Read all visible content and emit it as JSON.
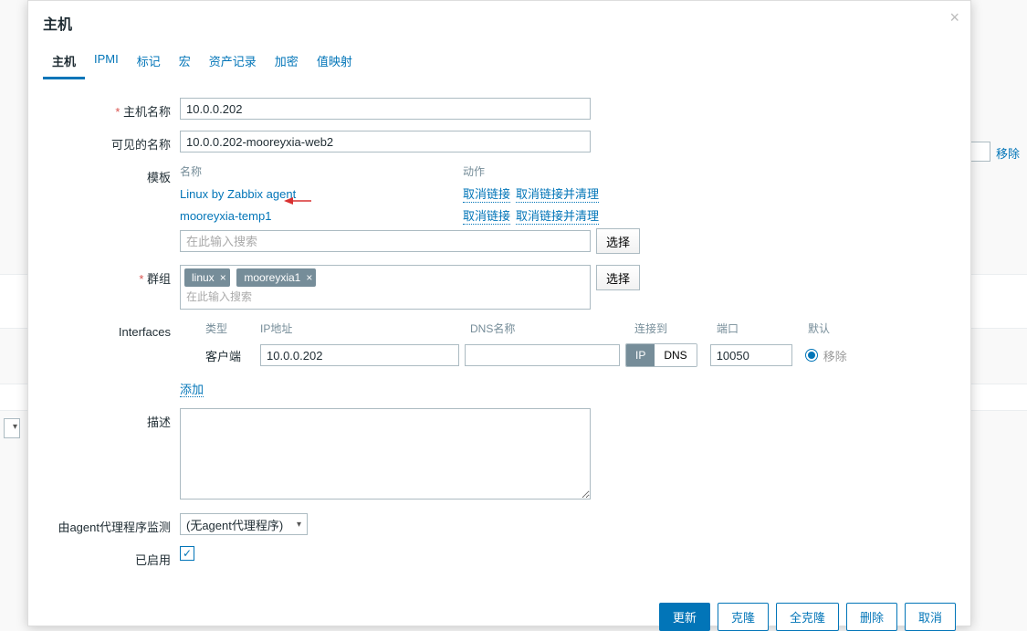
{
  "bg": {
    "remove_link": "移除"
  },
  "modal": {
    "title": "主机",
    "tabs": [
      "主机",
      "IPMI",
      "标记",
      "宏",
      "资产记录",
      "加密",
      "值映射"
    ],
    "active_tab": 0
  },
  "form": {
    "hostname_label": "主机名称",
    "hostname_value": "10.0.0.202",
    "visiblename_label": "可见的名称",
    "visiblename_value": "10.0.0.202-mooreyxia-web2",
    "template_label": "模板",
    "template_header_name": "名称",
    "template_header_action": "动作",
    "templates": [
      {
        "name": "Linux by Zabbix agent"
      },
      {
        "name": "mooreyxia-temp1"
      }
    ],
    "template_action_unlink": "取消链接",
    "template_action_clear": "取消链接并清理",
    "search_placeholder": "在此输入搜索",
    "select_btn": "选择",
    "group_label": "群组",
    "group_tags": [
      "linux",
      "mooreyxia1"
    ],
    "group_placeholder": "在此输入搜索",
    "interfaces_label": "Interfaces",
    "iface_headers": {
      "type": "类型",
      "ip": "IP地址",
      "dns": "DNS名称",
      "conn": "连接到",
      "port": "端口",
      "def": "默认"
    },
    "iface": {
      "type": "客户端",
      "ip": "10.0.0.202",
      "dns": "",
      "conn_ip": "IP",
      "conn_dns": "DNS",
      "port": "10050",
      "remove": "移除"
    },
    "add_link": "添加",
    "desc_label": "描述",
    "desc_value": "",
    "proxy_label": "由agent代理程序监测",
    "proxy_value": "(无agent代理程序)",
    "enabled_label": "已启用"
  },
  "footer": {
    "update": "更新",
    "clone": "克隆",
    "full_clone": "全克隆",
    "delete": "删除",
    "cancel": "取消"
  }
}
